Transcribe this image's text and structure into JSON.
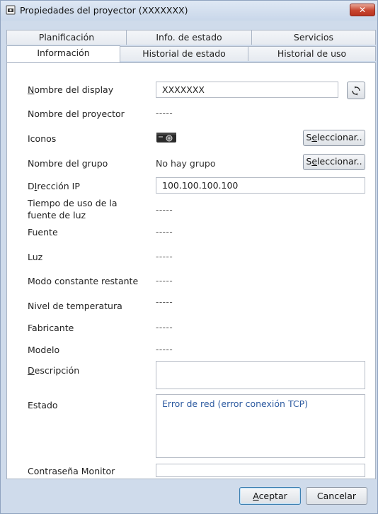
{
  "window": {
    "title": "Propiedades del proyector (XXXXXXX)",
    "close_label": "✕"
  },
  "tabs": {
    "row1": [
      "Planificación",
      "Info. de estado",
      "Servicios"
    ],
    "row2": [
      "Información",
      "Historial de estado",
      "Historial de uso"
    ],
    "active": "Información"
  },
  "form": {
    "display_name": {
      "label_u": "N",
      "label_rest": "ombre del display",
      "value": "XXXXXXX"
    },
    "projector_name": {
      "label": "Nombre del proyector",
      "value": "-----"
    },
    "icons": {
      "label": "Iconos",
      "button_pre": "S",
      "button_u": "e",
      "button_post": "leccionar.."
    },
    "group_name": {
      "label": "Nombre del grupo",
      "value": "No hay grupo",
      "button_pre": "S",
      "button_u": "e",
      "button_post": "leccionar.."
    },
    "ip": {
      "label_pre": "D",
      "label_u": "I",
      "label_post": "rección IP",
      "value": "100.100.100.100"
    },
    "light_usage": {
      "label_line1": "Tiempo de uso de la",
      "label_line2": "fuente de luz",
      "value": "-----"
    },
    "source": {
      "label": "Fuente",
      "value": "-----"
    },
    "light": {
      "label": "Luz",
      "value": "-----"
    },
    "constant_mode": {
      "label": "Modo constante restante",
      "value": "-----"
    },
    "temperature": {
      "label": "Nivel de temperatura",
      "value": "-----"
    },
    "manufacturer": {
      "label": "Fabricante",
      "value": "-----"
    },
    "model": {
      "label": "Modelo",
      "value": "-----"
    },
    "description": {
      "label_u": "D",
      "label_rest": "escripción",
      "value": ""
    },
    "status": {
      "label": "Estado",
      "value": "Error de red (error conexión TCP)"
    },
    "monitor_password": {
      "label": "Contraseña Monitor",
      "value": ""
    }
  },
  "footer": {
    "ok_u": "A",
    "ok_rest": "ceptar",
    "cancel": "Cancelar"
  },
  "icons": {
    "app": "projector-properties-icon",
    "refresh": "refresh-icon",
    "projector": "projector-icon"
  }
}
